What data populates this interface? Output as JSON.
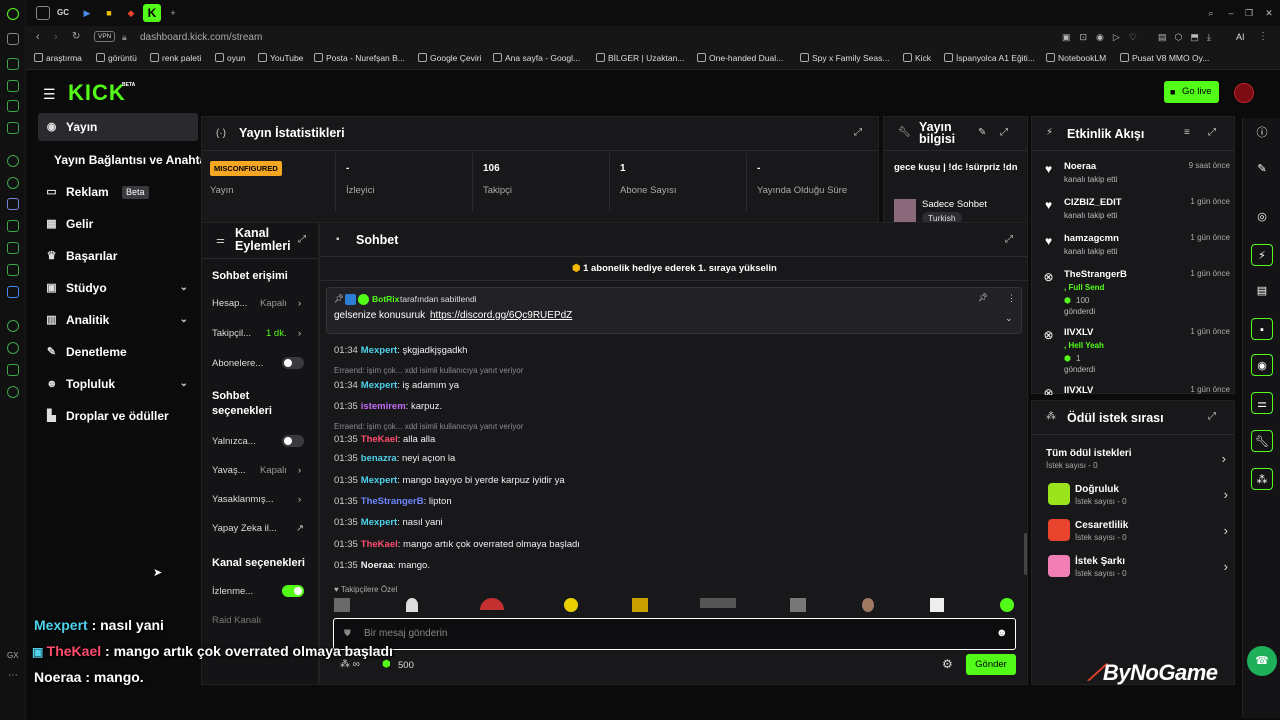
{
  "browser": {
    "url": "dashboard.kick.com/stream",
    "vpn": "VPN",
    "ai": "AI",
    "tab_gx": "GX",
    "tab_k": "K",
    "bookmarks": [
      "araştırma",
      "görüntü",
      "renk paleti",
      "oyun",
      "YouTube",
      "Posta - Nurefşan B...",
      "Google Çeviri",
      "Ana sayfa - Googl...",
      "BİLGER | Uzaktan...",
      "One-handed Dual...",
      "Spy x Family Seas...",
      "Kick",
      "İspanyolca A1 Eğiti...",
      "NotebookLM",
      "Pusat V8 MMO Oy..."
    ]
  },
  "kick": {
    "logo": "KICK",
    "beta": "BETA",
    "go_live": "Go live"
  },
  "nav": [
    {
      "label": "Yayın",
      "icon": "broadcast-icon"
    },
    {
      "label": "Yayın Bağlantısı ve Anahtarı",
      "icon": ""
    },
    {
      "label": "Reklam",
      "icon": "ad-icon",
      "badge": "Beta"
    },
    {
      "label": "Gelir",
      "icon": "revenue-icon"
    },
    {
      "label": "Başarılar",
      "icon": "trophy-icon"
    },
    {
      "label": "Stüdyo",
      "icon": "studio-icon"
    },
    {
      "label": "Analitik",
      "icon": "analytics-icon"
    },
    {
      "label": "Denetleme",
      "icon": "moderation-icon"
    },
    {
      "label": "Topluluk",
      "icon": "community-icon"
    },
    {
      "label": "Droplar ve ödüller",
      "icon": "drops-icon"
    }
  ],
  "stats": {
    "title": "Yayın İstatistikleri",
    "badge": "MISCONFIGURED",
    "stream_label": "Yayın",
    "items": [
      {
        "value": "-",
        "label": "İzleyici"
      },
      {
        "value": "106",
        "label": "Takipçi"
      },
      {
        "value": "1",
        "label": "Abone Sayısı"
      },
      {
        "value": "-",
        "label": "Yayında Olduğu Süre"
      }
    ]
  },
  "stream_info": {
    "title": "Yayın bilgisi",
    "text": "gece kuşu | !dc !sürpriz !dn",
    "category": "Sadece Sohbet",
    "tag": "Turkish"
  },
  "actions": {
    "title": "Kanal Eylemleri",
    "chat_access": "Sohbet erişimi",
    "opts": [
      {
        "label": "Hesap...",
        "value": "Kapalı"
      },
      {
        "label": "Takipçil...",
        "value": "1 dk."
      },
      {
        "label": "Abonelere...",
        "value": ""
      }
    ],
    "chat_settings": "Sohbet seçenekleri",
    "opts2": [
      {
        "label": "Yalnızca...",
        "value": ""
      },
      {
        "label": "Yavaş...",
        "value": "Kapalı"
      },
      {
        "label": "Yasaklanmış...",
        "value": ""
      },
      {
        "label": "Yapay Zeka il...",
        "value": ""
      }
    ],
    "channel_settings": "Kanal seçenekleri",
    "watch": "İzlenme...",
    "raid": "Raid Kanalı"
  },
  "chat": {
    "title": "Sohbet",
    "gift_banner": "1 abonelik hediye ederek 1. sıraya yükselin",
    "pinned_by": "BotRix",
    "pinned_suffix": "tarafından sabitlendi",
    "pinned_text": "gelsenize konusuruk",
    "pinned_link": "https://discord.gg/6Qc9RUEPdZ",
    "messages": [
      {
        "time": "01:34",
        "user": "Mexpert",
        "color": "#4fd1ea",
        "text": ": şkgjadkjşgadkh"
      },
      {
        "reply": "Erraend: işim çok... xdd isimli kullanıcıya yanıt veriyor"
      },
      {
        "time": "01:34",
        "user": "Mexpert",
        "color": "#4fd1ea",
        "text": ": iş adamım ya"
      },
      {
        "time": "01:35",
        "user": "istemirem",
        "color": "#c46cf5",
        "text": ": karpuz."
      },
      {
        "reply": "Erraend: işim çok... xdd isimli kullanıcıya yanıt veriyor"
      },
      {
        "time": "01:35",
        "user": "TheKael",
        "color": "#ff4d6d",
        "text": ": alla alla"
      },
      {
        "time": "01:35",
        "user": "benazra",
        "color": "#4fd1ea",
        "text": ": neyi açıon la"
      },
      {
        "time": "01:35",
        "user": "Mexpert",
        "color": "#4fd1ea",
        "text": ": mango bayıyo bi yerde karpuz iyidir ya"
      },
      {
        "time": "01:35",
        "user": "TheStrangerB",
        "color": "#6f86ff",
        "text": ": lipton"
      },
      {
        "time": "01:35",
        "user": "Mexpert",
        "color": "#4fd1ea",
        "text": ": nasıl yani"
      },
      {
        "time": "01:35",
        "user": "TheKael",
        "color": "#ff4d6d",
        "text": ": mango artık çok overrated olmaya başladı"
      },
      {
        "time": "01:35",
        "user": "Noeraa",
        "color": "#efeff1",
        "text": ": mango."
      }
    ],
    "followers_only": "Takipçilere Özel",
    "placeholder": "Bir mesaj gönderin",
    "points": "500",
    "send": "Gönder"
  },
  "activity": {
    "title": "Etkinlik Akışı",
    "items": [
      {
        "name": "Noeraa",
        "sub": "kanalı takip etti",
        "time": "9 saat önce",
        "icon": "heart-icon"
      },
      {
        "name": "CIZBIZ_EDIT",
        "sub": "kanalı takip etti",
        "time": "1 gün önce",
        "icon": "heart-icon"
      },
      {
        "name": "hamzagcmn",
        "sub": "kanalı takip etti",
        "time": "1 gün önce",
        "icon": "heart-icon"
      },
      {
        "name": "TheStrangerB",
        "sub": ", Full Send",
        "amount": "100",
        "sent": "gönderdi",
        "time": "1 gün önce",
        "icon": "kick-icon"
      },
      {
        "name": "IIVXLV",
        "sub": ", Hell Yeah",
        "amount": "1",
        "sent": "gönderdi",
        "time": "1 gün önce",
        "icon": "kick-icon"
      },
      {
        "name": "IIVXLV",
        "time": "1 gün önce",
        "icon": "kick-icon"
      }
    ]
  },
  "rewards": {
    "title": "Ödül istek sırası",
    "items": [
      {
        "name": "Tüm ödül istekleri",
        "sub": "İstek sayısı - 0",
        "color": ""
      },
      {
        "name": "Doğruluk",
        "sub": "İstek sayısı - 0",
        "color": "#9be41d"
      },
      {
        "name": "Cesaretlilik",
        "sub": "İstek sayısı - 0",
        "color": "#e8432c"
      },
      {
        "name": "İstek Şarkı",
        "sub": "İstek sayısı - 0",
        "color": "#f17fb6"
      }
    ]
  },
  "overlay": [
    {
      "user": "Mexpert",
      "color": "#4fd1ea",
      "text": " : nasıl yani"
    },
    {
      "user": "TheKael",
      "color": "#ff4d6d",
      "text": " : mango artık çok overrated olmaya başladı"
    },
    {
      "user": "Noeraa",
      "color": "#ffffff",
      "text": " : mango."
    }
  ],
  "watermark": "ByNoGame",
  "colors": {
    "accent": "#53fc18",
    "panel": "#18181b"
  }
}
